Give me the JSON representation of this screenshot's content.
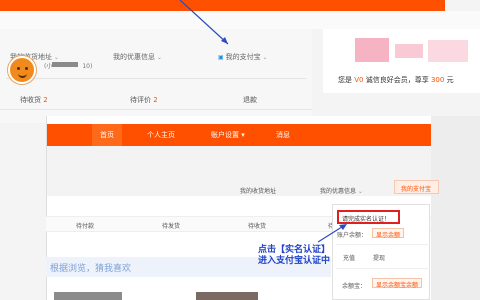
{
  "background": {
    "links": [
      "我的收货地址",
      "我的优惠信息",
      "我的支付宝"
    ],
    "stats": [
      {
        "label": "待收货",
        "count": "2"
      },
      {
        "label": "待评价",
        "count": "2"
      },
      {
        "label": "退款",
        "count": ""
      }
    ],
    "vip": {
      "prefix": "您是",
      "level": "V0",
      "middle": "诚信良好会员，尊享",
      "amount": "300",
      "suffix": "元"
    }
  },
  "window": {
    "nav": [
      "首页",
      "个人主页",
      "账户设置",
      "消息"
    ],
    "username": "(小",
    "username_suffix": "10)",
    "links": [
      "我的收货地址",
      "我的优惠信息"
    ],
    "alipay_button": "我的支付宝",
    "stats": [
      "待付款",
      "待发货",
      "待收货",
      "待评价"
    ],
    "guess_text": "根据浏览，猜我喜欢"
  },
  "popup": {
    "verify": "请完成实名认证！",
    "balance_label": "账户余额：",
    "show_balance": "显示余额",
    "recharge": "充值",
    "withdraw": "提现",
    "yuebao_label": "余额宝：",
    "show_yuebao": "显示余额宝余额"
  },
  "annotation": {
    "line1": "点击【实名认证】",
    "line2": "进入支付宝认证中"
  },
  "colors": {
    "brand": "#ff5000",
    "annotation": "#2244c8",
    "highlight": "#e02020"
  }
}
